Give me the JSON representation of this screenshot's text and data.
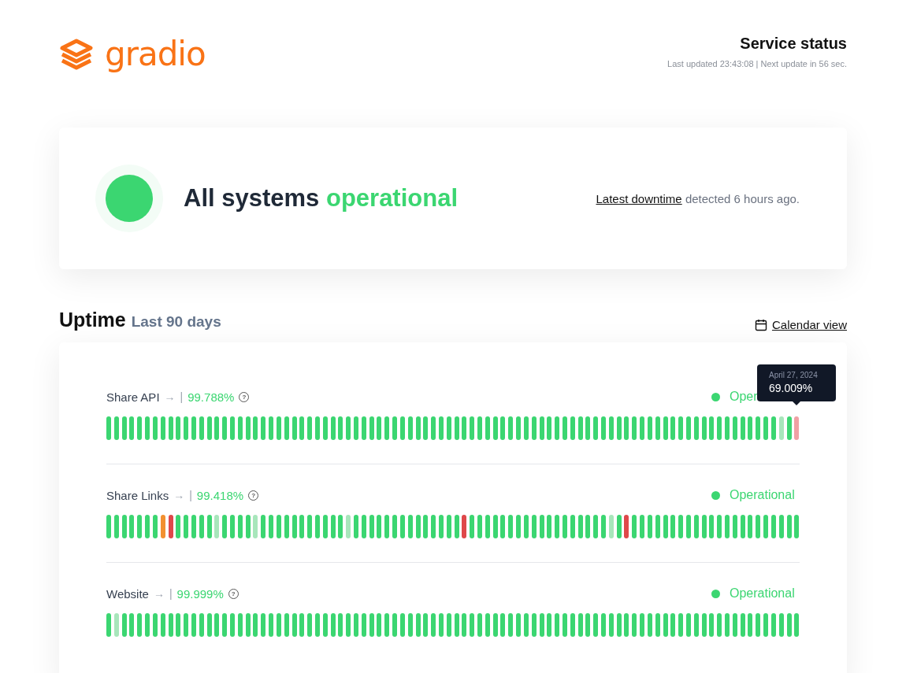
{
  "brand": {
    "name": "gradio"
  },
  "header": {
    "title": "Service status",
    "updated": "Last updated 23:43:08 | Next update in 56 sec."
  },
  "summary": {
    "text_plain": "All systems",
    "text_status": "operational",
    "link": "Latest downtime",
    "suffix": "detected 6 hours ago."
  },
  "uptime": {
    "title": "Uptime",
    "subtitle": "Last 90 days",
    "calendar_link": "Calendar view"
  },
  "services": [
    {
      "name": "Share API",
      "arrow": "→",
      "separator": "|",
      "percent": "99.788%",
      "help": "?",
      "status_label": "Oper",
      "tooltip": {
        "date": "April 27, 2024",
        "value": "69.009%"
      },
      "days": [
        {
          "color": "#3bd671"
        },
        {
          "color": "#3bd671"
        },
        {
          "color": "#3bd671"
        },
        {
          "color": "#3bd671"
        },
        {
          "color": "#3bd671"
        },
        {
          "color": "#3bd671"
        },
        {
          "color": "#3bd671"
        },
        {
          "color": "#3bd671"
        },
        {
          "color": "#3bd671"
        },
        {
          "color": "#3bd671"
        },
        {
          "color": "#3bd671"
        },
        {
          "color": "#3bd671"
        },
        {
          "color": "#3bd671"
        },
        {
          "color": "#3bd671"
        },
        {
          "color": "#3bd671"
        },
        {
          "color": "#3bd671"
        },
        {
          "color": "#3bd671"
        },
        {
          "color": "#3bd671"
        },
        {
          "color": "#3bd671"
        },
        {
          "color": "#3bd671"
        },
        {
          "color": "#3bd671"
        },
        {
          "color": "#3bd671"
        },
        {
          "color": "#3bd671"
        },
        {
          "color": "#3bd671"
        },
        {
          "color": "#3bd671"
        },
        {
          "color": "#3bd671"
        },
        {
          "color": "#3bd671"
        },
        {
          "color": "#3bd671"
        },
        {
          "color": "#3bd671"
        },
        {
          "color": "#3bd671"
        },
        {
          "color": "#3bd671"
        },
        {
          "color": "#3bd671"
        },
        {
          "color": "#3bd671"
        },
        {
          "color": "#3bd671"
        },
        {
          "color": "#3bd671"
        },
        {
          "color": "#3bd671"
        },
        {
          "color": "#3bd671"
        },
        {
          "color": "#3bd671"
        },
        {
          "color": "#3bd671"
        },
        {
          "color": "#3bd671"
        },
        {
          "color": "#3bd671"
        },
        {
          "color": "#3bd671"
        },
        {
          "color": "#3bd671"
        },
        {
          "color": "#3bd671"
        },
        {
          "color": "#3bd671"
        },
        {
          "color": "#3bd671"
        },
        {
          "color": "#3bd671"
        },
        {
          "color": "#3bd671"
        },
        {
          "color": "#3bd671"
        },
        {
          "color": "#3bd671"
        },
        {
          "color": "#3bd671"
        },
        {
          "color": "#3bd671"
        },
        {
          "color": "#3bd671"
        },
        {
          "color": "#3bd671"
        },
        {
          "color": "#3bd671"
        },
        {
          "color": "#3bd671"
        },
        {
          "color": "#3bd671"
        },
        {
          "color": "#3bd671"
        },
        {
          "color": "#3bd671"
        },
        {
          "color": "#3bd671"
        },
        {
          "color": "#3bd671"
        },
        {
          "color": "#3bd671"
        },
        {
          "color": "#3bd671"
        },
        {
          "color": "#3bd671"
        },
        {
          "color": "#3bd671"
        },
        {
          "color": "#3bd671"
        },
        {
          "color": "#3bd671"
        },
        {
          "color": "#3bd671"
        },
        {
          "color": "#3bd671"
        },
        {
          "color": "#3bd671"
        },
        {
          "color": "#3bd671"
        },
        {
          "color": "#3bd671"
        },
        {
          "color": "#3bd671"
        },
        {
          "color": "#3bd671"
        },
        {
          "color": "#3bd671"
        },
        {
          "color": "#3bd671"
        },
        {
          "color": "#3bd671"
        },
        {
          "color": "#3bd671"
        },
        {
          "color": "#3bd671"
        },
        {
          "color": "#3bd671"
        },
        {
          "color": "#3bd671"
        },
        {
          "color": "#3bd671"
        },
        {
          "color": "#3bd671"
        },
        {
          "color": "#3bd671"
        },
        {
          "color": "#3bd671"
        },
        {
          "color": "#3bd671"
        },
        {
          "color": "#3bd671"
        },
        {
          "color": "#a8e6bb"
        },
        {
          "color": "#3bd671"
        },
        {
          "color": "#f0a1a4"
        }
      ]
    },
    {
      "name": "Share Links",
      "arrow": "→",
      "separator": "|",
      "percent": "99.418%",
      "help": "?",
      "status_label": "Operational",
      "days": [
        {
          "color": "#3bd671"
        },
        {
          "color": "#3bd671"
        },
        {
          "color": "#3bd671"
        },
        {
          "color": "#3bd671"
        },
        {
          "color": "#3bd671"
        },
        {
          "color": "#3bd671"
        },
        {
          "color": "#3bd671"
        },
        {
          "color": "#f29030"
        },
        {
          "color": "#df484a"
        },
        {
          "color": "#3bd671"
        },
        {
          "color": "#3bd671"
        },
        {
          "color": "#3bd671"
        },
        {
          "color": "#3bd671"
        },
        {
          "color": "#3bd671"
        },
        {
          "color": "#a8e6bb"
        },
        {
          "color": "#3bd671"
        },
        {
          "color": "#3bd671"
        },
        {
          "color": "#3bd671"
        },
        {
          "color": "#3bd671"
        },
        {
          "color": "#a8e6bb"
        },
        {
          "color": "#3bd671"
        },
        {
          "color": "#3bd671"
        },
        {
          "color": "#3bd671"
        },
        {
          "color": "#3bd671"
        },
        {
          "color": "#3bd671"
        },
        {
          "color": "#3bd671"
        },
        {
          "color": "#3bd671"
        },
        {
          "color": "#3bd671"
        },
        {
          "color": "#3bd671"
        },
        {
          "color": "#3bd671"
        },
        {
          "color": "#3bd671"
        },
        {
          "color": "#a8e6bb"
        },
        {
          "color": "#3bd671"
        },
        {
          "color": "#3bd671"
        },
        {
          "color": "#3bd671"
        },
        {
          "color": "#3bd671"
        },
        {
          "color": "#3bd671"
        },
        {
          "color": "#3bd671"
        },
        {
          "color": "#3bd671"
        },
        {
          "color": "#3bd671"
        },
        {
          "color": "#3bd671"
        },
        {
          "color": "#3bd671"
        },
        {
          "color": "#3bd671"
        },
        {
          "color": "#3bd671"
        },
        {
          "color": "#3bd671"
        },
        {
          "color": "#3bd671"
        },
        {
          "color": "#df484a"
        },
        {
          "color": "#3bd671"
        },
        {
          "color": "#3bd671"
        },
        {
          "color": "#3bd671"
        },
        {
          "color": "#3bd671"
        },
        {
          "color": "#3bd671"
        },
        {
          "color": "#3bd671"
        },
        {
          "color": "#3bd671"
        },
        {
          "color": "#3bd671"
        },
        {
          "color": "#3bd671"
        },
        {
          "color": "#3bd671"
        },
        {
          "color": "#3bd671"
        },
        {
          "color": "#3bd671"
        },
        {
          "color": "#3bd671"
        },
        {
          "color": "#3bd671"
        },
        {
          "color": "#3bd671"
        },
        {
          "color": "#3bd671"
        },
        {
          "color": "#3bd671"
        },
        {
          "color": "#3bd671"
        },
        {
          "color": "#a8e6bb"
        },
        {
          "color": "#3bd671"
        },
        {
          "color": "#df484a"
        },
        {
          "color": "#3bd671"
        },
        {
          "color": "#3bd671"
        },
        {
          "color": "#3bd671"
        },
        {
          "color": "#3bd671"
        },
        {
          "color": "#3bd671"
        },
        {
          "color": "#3bd671"
        },
        {
          "color": "#3bd671"
        },
        {
          "color": "#3bd671"
        },
        {
          "color": "#3bd671"
        },
        {
          "color": "#3bd671"
        },
        {
          "color": "#3bd671"
        },
        {
          "color": "#3bd671"
        },
        {
          "color": "#3bd671"
        },
        {
          "color": "#3bd671"
        },
        {
          "color": "#3bd671"
        },
        {
          "color": "#3bd671"
        },
        {
          "color": "#3bd671"
        },
        {
          "color": "#3bd671"
        },
        {
          "color": "#3bd671"
        },
        {
          "color": "#3bd671"
        },
        {
          "color": "#3bd671"
        },
        {
          "color": "#3bd671"
        }
      ]
    },
    {
      "name": "Website",
      "arrow": "→",
      "separator": "|",
      "percent": "99.999%",
      "help": "?",
      "status_label": "Operational",
      "days": [
        {
          "color": "#3bd671"
        },
        {
          "color": "#a8e6bb"
        },
        {
          "color": "#3bd671"
        },
        {
          "color": "#3bd671"
        },
        {
          "color": "#3bd671"
        },
        {
          "color": "#3bd671"
        },
        {
          "color": "#3bd671"
        },
        {
          "color": "#3bd671"
        },
        {
          "color": "#3bd671"
        },
        {
          "color": "#3bd671"
        },
        {
          "color": "#3bd671"
        },
        {
          "color": "#3bd671"
        },
        {
          "color": "#3bd671"
        },
        {
          "color": "#3bd671"
        },
        {
          "color": "#3bd671"
        },
        {
          "color": "#3bd671"
        },
        {
          "color": "#3bd671"
        },
        {
          "color": "#3bd671"
        },
        {
          "color": "#3bd671"
        },
        {
          "color": "#3bd671"
        },
        {
          "color": "#3bd671"
        },
        {
          "color": "#3bd671"
        },
        {
          "color": "#3bd671"
        },
        {
          "color": "#3bd671"
        },
        {
          "color": "#3bd671"
        },
        {
          "color": "#3bd671"
        },
        {
          "color": "#3bd671"
        },
        {
          "color": "#3bd671"
        },
        {
          "color": "#3bd671"
        },
        {
          "color": "#3bd671"
        },
        {
          "color": "#3bd671"
        },
        {
          "color": "#3bd671"
        },
        {
          "color": "#3bd671"
        },
        {
          "color": "#3bd671"
        },
        {
          "color": "#3bd671"
        },
        {
          "color": "#3bd671"
        },
        {
          "color": "#3bd671"
        },
        {
          "color": "#3bd671"
        },
        {
          "color": "#3bd671"
        },
        {
          "color": "#3bd671"
        },
        {
          "color": "#3bd671"
        },
        {
          "color": "#3bd671"
        },
        {
          "color": "#3bd671"
        },
        {
          "color": "#3bd671"
        },
        {
          "color": "#3bd671"
        },
        {
          "color": "#3bd671"
        },
        {
          "color": "#3bd671"
        },
        {
          "color": "#3bd671"
        },
        {
          "color": "#3bd671"
        },
        {
          "color": "#3bd671"
        },
        {
          "color": "#3bd671"
        },
        {
          "color": "#3bd671"
        },
        {
          "color": "#3bd671"
        },
        {
          "color": "#3bd671"
        },
        {
          "color": "#3bd671"
        },
        {
          "color": "#3bd671"
        },
        {
          "color": "#3bd671"
        },
        {
          "color": "#3bd671"
        },
        {
          "color": "#3bd671"
        },
        {
          "color": "#3bd671"
        },
        {
          "color": "#3bd671"
        },
        {
          "color": "#3bd671"
        },
        {
          "color": "#3bd671"
        },
        {
          "color": "#3bd671"
        },
        {
          "color": "#3bd671"
        },
        {
          "color": "#3bd671"
        },
        {
          "color": "#3bd671"
        },
        {
          "color": "#3bd671"
        },
        {
          "color": "#3bd671"
        },
        {
          "color": "#3bd671"
        },
        {
          "color": "#3bd671"
        },
        {
          "color": "#3bd671"
        },
        {
          "color": "#3bd671"
        },
        {
          "color": "#3bd671"
        },
        {
          "color": "#3bd671"
        },
        {
          "color": "#3bd671"
        },
        {
          "color": "#3bd671"
        },
        {
          "color": "#3bd671"
        },
        {
          "color": "#3bd671"
        },
        {
          "color": "#3bd671"
        },
        {
          "color": "#3bd671"
        },
        {
          "color": "#3bd671"
        },
        {
          "color": "#3bd671"
        },
        {
          "color": "#3bd671"
        },
        {
          "color": "#3bd671"
        },
        {
          "color": "#3bd671"
        },
        {
          "color": "#3bd671"
        },
        {
          "color": "#3bd671"
        },
        {
          "color": "#3bd671"
        },
        {
          "color": "#3bd671"
        }
      ]
    }
  ]
}
